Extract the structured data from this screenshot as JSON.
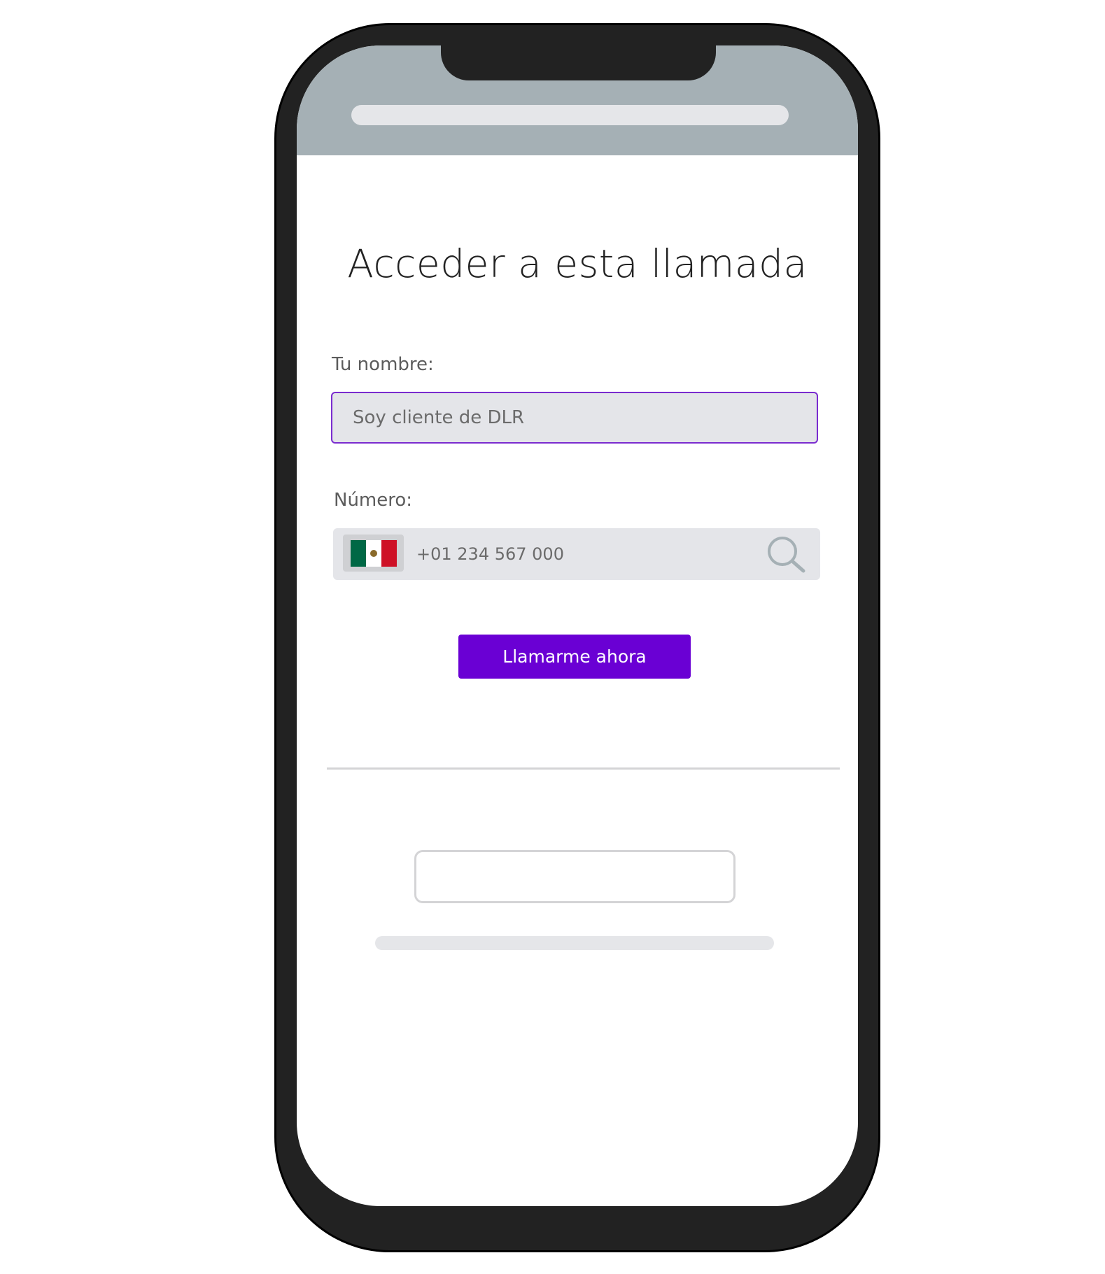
{
  "form": {
    "title": "Acceder a esta llamada",
    "name_label": "Tu nombre:",
    "name_placeholder": "Soy cliente de DLR",
    "number_label": "Número:",
    "number_placeholder": "+01 234 567 000",
    "country_flag": "mexico-flag-icon",
    "submit_label": "Llamarme ahora"
  },
  "colors": {
    "accent": "#6a00d4",
    "field_border_focus": "#7a2ccf",
    "field_bg": "#e4e5e9",
    "status_bar": "#a5b0b5",
    "device_body": "#222222"
  }
}
